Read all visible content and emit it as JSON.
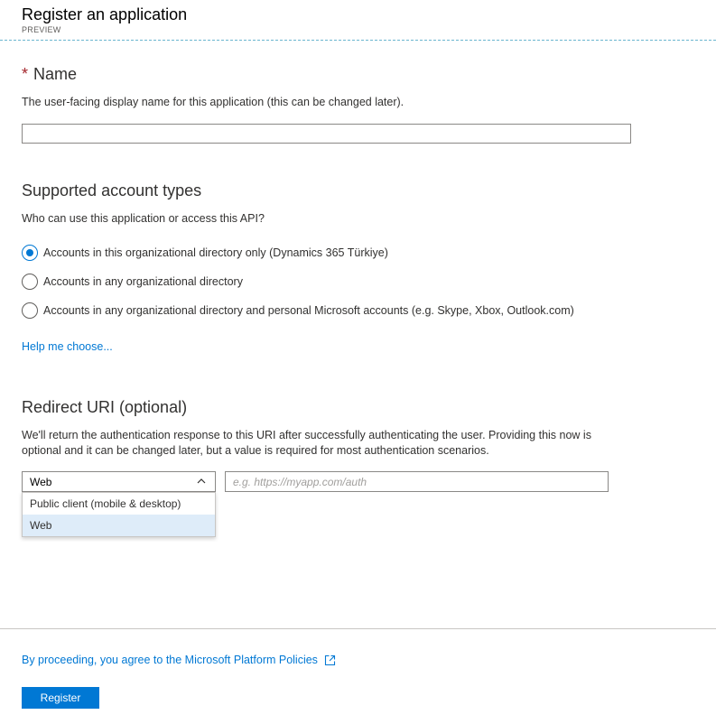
{
  "header": {
    "title": "Register an application",
    "subtitle": "PREVIEW"
  },
  "name_section": {
    "required_mark": "*",
    "title": "Name",
    "description": "The user-facing display name for this application (this can be changed later).",
    "input_value": ""
  },
  "account_types": {
    "title": "Supported account types",
    "description": "Who can use this application or access this API?",
    "options": [
      {
        "label": "Accounts in this organizational directory only (Dynamics 365 Türkiye)",
        "checked": true
      },
      {
        "label": "Accounts in any organizational directory",
        "checked": false
      },
      {
        "label": "Accounts in any organizational directory and personal Microsoft accounts (e.g. Skype, Xbox, Outlook.com)",
        "checked": false
      }
    ],
    "help_link": "Help me choose..."
  },
  "redirect": {
    "title": "Redirect URI (optional)",
    "description_line1": "We'll return the authentication response to this URI after successfully authenticating the user. Providing this now is",
    "description_line2": "optional and it can be changed later, but a value is required for most authentication scenarios.",
    "selected_type": "Web",
    "dropdown_options": [
      "Public client (mobile & desktop)",
      "Web"
    ],
    "uri_placeholder": "e.g. https://myapp.com/auth",
    "uri_value": ""
  },
  "footer": {
    "policy_text": "By proceeding, you agree to the Microsoft Platform Policies",
    "register_label": "Register"
  },
  "colors": {
    "accent": "#0078d4",
    "required": "#a4262c",
    "selected_bg": "#deecf9"
  },
  "icons": {
    "chevron": "chevron-up-icon",
    "external": "external-link-icon"
  }
}
